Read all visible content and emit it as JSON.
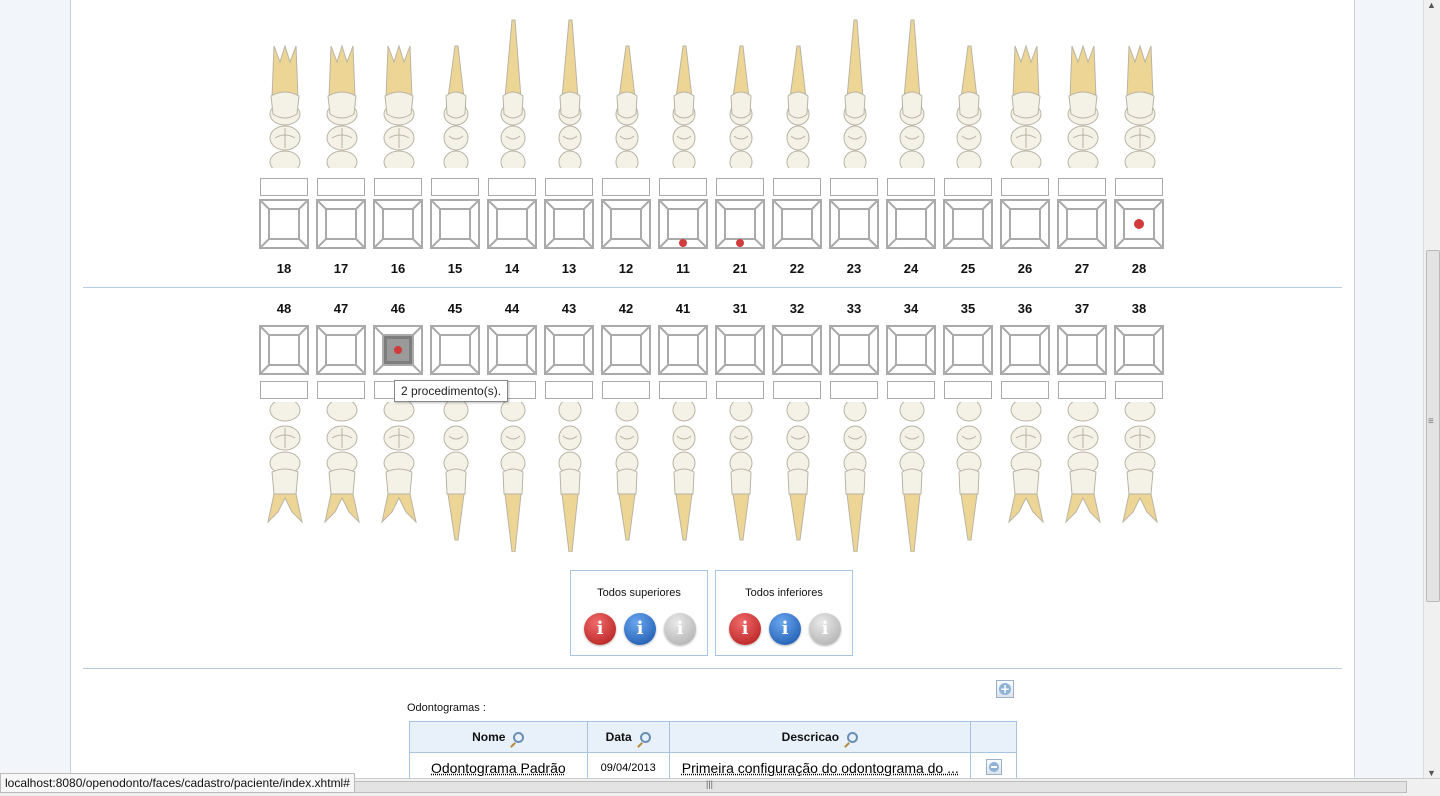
{
  "upper_teeth": [
    "18",
    "17",
    "16",
    "15",
    "14",
    "13",
    "12",
    "11",
    "21",
    "22",
    "23",
    "24",
    "25",
    "26",
    "27",
    "28"
  ],
  "lower_teeth": [
    "48",
    "47",
    "46",
    "45",
    "44",
    "43",
    "42",
    "41",
    "31",
    "32",
    "33",
    "34",
    "35",
    "36",
    "37",
    "38"
  ],
  "tooltip": "2 procedimento(s).",
  "selection_panels": [
    {
      "title": "Todos superiores",
      "buttons": [
        "i",
        "i",
        "i"
      ]
    },
    {
      "title": "Todos inferiores",
      "buttons": [
        "i",
        "i",
        "i"
      ]
    }
  ],
  "odontogram_list_label": "Odontogramas :",
  "table": {
    "headers": [
      "Nome",
      "Data",
      "Descricao"
    ],
    "rows": [
      {
        "nome": "Odontograma Padrão",
        "data": "09/04/2013",
        "descricao": "Primeira configuração do odontograma do ..."
      }
    ]
  },
  "status_url": "localhost:8080/openodonto/faces/cadastro/paciente/index.xhtml#",
  "colors": {
    "marker": "#d23b3b",
    "panel_border": "#a7c4e3",
    "header_bg": "#e8f0fa"
  }
}
